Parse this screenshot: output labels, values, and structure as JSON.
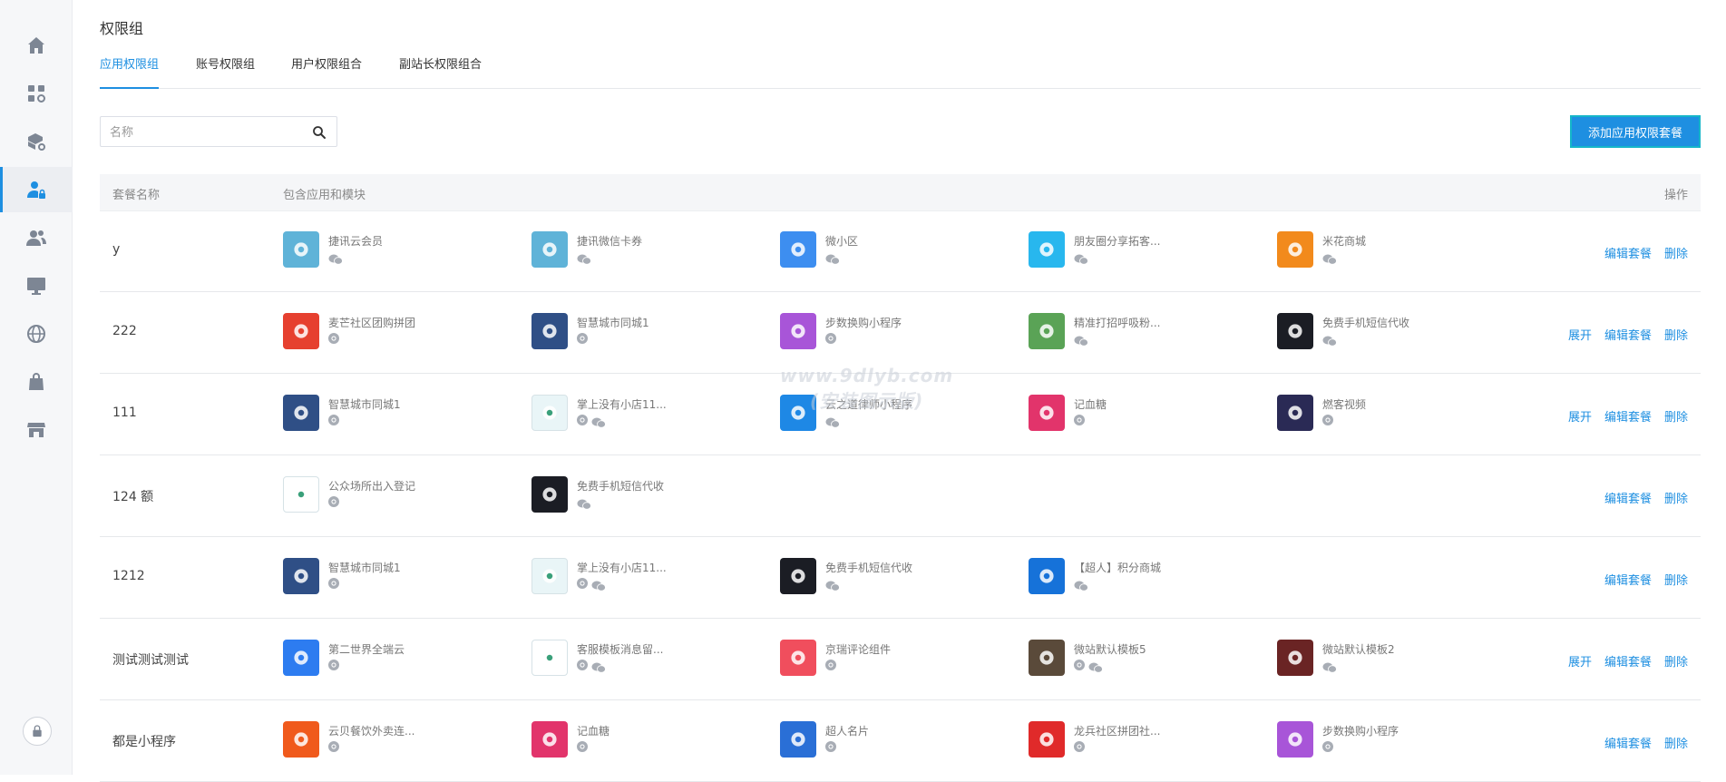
{
  "sidebar": {
    "items": [
      {
        "icon": "home-icon"
      },
      {
        "icon": "apps-settings-icon"
      },
      {
        "icon": "package-settings-icon"
      },
      {
        "icon": "user-lock-icon",
        "active": true
      },
      {
        "icon": "users-icon"
      },
      {
        "icon": "monitor-icon"
      },
      {
        "icon": "globe-icon"
      },
      {
        "icon": "shopping-bag-icon"
      },
      {
        "icon": "store-icon"
      }
    ],
    "bottom_icon": "lock-icon"
  },
  "page": {
    "title": "权限组"
  },
  "tabs": [
    {
      "label": "应用权限组",
      "active": true
    },
    {
      "label": "账号权限组"
    },
    {
      "label": "用户权限组合"
    },
    {
      "label": "副站长权限组合"
    }
  ],
  "search": {
    "placeholder": "名称",
    "value": ""
  },
  "add_button": {
    "label": "添加应用权限套餐"
  },
  "table": {
    "headers": {
      "name": "套餐名称",
      "apps": "包含应用和模块",
      "ops": "操作"
    },
    "rows": [
      {
        "name": "y",
        "ops": [
          "编辑套餐",
          "删除"
        ],
        "apps": [
          {
            "name": "捷讯云会员",
            "icon": "card-icon",
            "color": "#5fb3d8",
            "badges": [
              "wechat"
            ]
          },
          {
            "name": "捷讯微信卡券",
            "icon": "card-plus-icon",
            "color": "#5fb3d8",
            "badges": [
              "wechat"
            ]
          },
          {
            "name": "微小区",
            "icon": "house-smile-icon",
            "color": "#3d8ef0",
            "badges": [
              "wechat"
            ]
          },
          {
            "name": "朋友圈分享拓客...",
            "icon": "m-logo-icon",
            "color": "#28b7ee",
            "badges": [
              "wechat"
            ]
          },
          {
            "name": "米花商城",
            "icon": "flower-icon",
            "color": "#f28a1c",
            "badges": [
              "wechat"
            ]
          }
        ]
      },
      {
        "name": "222",
        "ops": [
          "展开",
          "编辑套餐",
          "删除"
        ],
        "apps": [
          {
            "name": "麦芒社区团购拼团",
            "icon": "shop-cart-icon",
            "color": "#e6402f",
            "badges": [
              "link"
            ]
          },
          {
            "name": "智慧城市同城1",
            "icon": "city-icon",
            "color": "#2f4f86",
            "badges": [
              "link"
            ]
          },
          {
            "name": "步数换购小程序",
            "icon": "steps-icon",
            "color": "#a855d8",
            "badges": [
              "link"
            ]
          },
          {
            "name": "精准打招呼吸粉...",
            "icon": "robot-icon",
            "color": "#5aa356",
            "badges": [
              "wechat"
            ]
          },
          {
            "name": "免费手机短信代收",
            "icon": "go-chat-icon",
            "color": "#1b1d24",
            "badges": [
              "wechat"
            ]
          }
        ]
      },
      {
        "name": "111",
        "ops": [
          "展开",
          "编辑套餐",
          "删除"
        ],
        "apps": [
          {
            "name": "智慧城市同城1",
            "icon": "city-icon",
            "color": "#2f4f86",
            "badges": [
              "link"
            ]
          },
          {
            "name": "掌上没有小店11...",
            "icon": "store-cart-icon",
            "color": "#e9f5f7",
            "badges": [
              "link",
              "wechat"
            ]
          },
          {
            "name": "云之道律师小程序",
            "icon": "scale-icon",
            "color": "#1e88e5",
            "badges": [
              "wechat"
            ]
          },
          {
            "name": "记血糖",
            "icon": "blood-drop-icon",
            "color": "#e2346b",
            "badges": [
              "link"
            ]
          },
          {
            "name": "燃客视频",
            "icon": "video-icon",
            "color": "#2a2a55",
            "badges": [
              "link"
            ]
          }
        ]
      },
      {
        "name": "124 额",
        "ops": [
          "编辑套餐",
          "删除"
        ],
        "apps": [
          {
            "name": "公众场所出入登记",
            "icon": "house-check-icon",
            "color": "#ffffff",
            "badges": [
              "link"
            ]
          },
          {
            "name": "免费手机短信代收",
            "icon": "go-chat-icon",
            "color": "#1b1d24",
            "badges": [
              "wechat"
            ]
          }
        ]
      },
      {
        "name": "1212",
        "ops": [
          "编辑套餐",
          "删除"
        ],
        "apps": [
          {
            "name": "智慧城市同城1",
            "icon": "city-icon",
            "color": "#2f4f86",
            "badges": [
              "link"
            ]
          },
          {
            "name": "掌上没有小店11...",
            "icon": "store-cart-icon",
            "color": "#e9f5f7",
            "badges": [
              "link",
              "wechat"
            ]
          },
          {
            "name": "免费手机短信代收",
            "icon": "go-chat-icon",
            "color": "#1b1d24",
            "badges": [
              "wechat"
            ]
          },
          {
            "name": "【超人】积分商城",
            "icon": "points-mall-icon",
            "color": "#1672d9",
            "badges": [
              "wechat"
            ]
          }
        ]
      },
      {
        "name": "测试测试测试",
        "ops": [
          "展开",
          "编辑套餐",
          "删除"
        ],
        "apps": [
          {
            "name": "第二世界全端云",
            "icon": "cloud-badge-icon",
            "color": "#2d7cf0",
            "badges": [
              "link"
            ]
          },
          {
            "name": "客服模板消息留...",
            "icon": "wechat-logo-icon",
            "color": "#ffffff",
            "badges": [
              "link",
              "wechat"
            ]
          },
          {
            "name": "京瑞评论组件",
            "icon": "cat-face-icon",
            "color": "#f04e5d",
            "badges": [
              "link"
            ]
          },
          {
            "name": "微站默认模板5",
            "icon": "photo-car-icon",
            "color": "#5a4a3a",
            "badges": [
              "link",
              "wechat"
            ]
          },
          {
            "name": "微站默认模板2",
            "icon": "photo-room-icon",
            "color": "#6a2424",
            "badges": [
              "wechat"
            ]
          }
        ]
      },
      {
        "name": "都是小程序",
        "ops": [
          "编辑套餐",
          "删除"
        ],
        "apps": [
          {
            "name": "云贝餐饮外卖连...",
            "icon": "cloud-food-icon",
            "color": "#f05a1c",
            "badges": [
              "link"
            ]
          },
          {
            "name": "记血糖",
            "icon": "blood-drop-icon",
            "color": "#e2346b",
            "badges": [
              "link"
            ]
          },
          {
            "name": "超人名片",
            "icon": "id-card-icon",
            "color": "#2a6fd6",
            "badges": [
              "link"
            ]
          },
          {
            "name": "龙兵社区拼团社...",
            "icon": "star-badge-icon",
            "color": "#e02a2a",
            "badges": [
              "link"
            ]
          },
          {
            "name": "步数换购小程序",
            "icon": "steps-icon",
            "color": "#a855d8",
            "badges": [
              "link"
            ]
          }
        ]
      }
    ]
  },
  "watermark": {
    "line1": "www.9dlyb.com",
    "line2": "(安装图示版)"
  }
}
